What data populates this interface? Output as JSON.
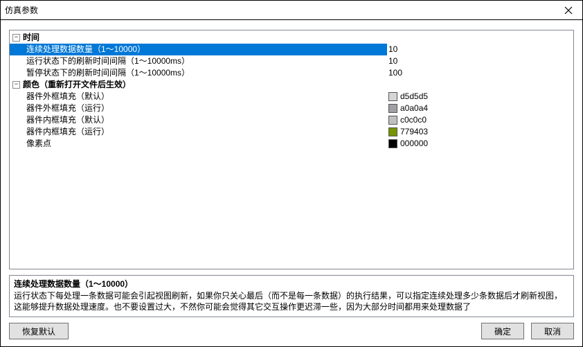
{
  "window": {
    "title": "仿真参数"
  },
  "groups": {
    "time": {
      "label": "时间",
      "items": {
        "cont_count": {
          "label": "连续处理数据数量（1～10000）",
          "value": "10"
        },
        "run_refresh": {
          "label": "运行状态下的刷新时间间隔（1～10000ms）",
          "value": "10"
        },
        "pause_refresh": {
          "label": "暂停状态下的刷新时间间隔（1～10000ms）",
          "value": "100"
        }
      }
    },
    "color": {
      "label": "颜色（重新打开文件后生效）",
      "items": {
        "outer_fill_default": {
          "label": "器件外框填充（默认）",
          "value": "d5d5d5",
          "hex": "#d5d5d5"
        },
        "outer_fill_run": {
          "label": "器件外框填充（运行）",
          "value": "a0a0a4",
          "hex": "#a0a0a4"
        },
        "inner_fill_default": {
          "label": "器件内框填充（默认）",
          "value": "c0c0c0",
          "hex": "#c0c0c0"
        },
        "inner_fill_run": {
          "label": "器件内框填充（运行）",
          "value": "779403",
          "hex": "#779403"
        },
        "pixel": {
          "label": "像素点",
          "value": "000000",
          "hex": "#000000"
        }
      }
    }
  },
  "help": {
    "title": "连续处理数据数量（1～10000）",
    "text": "运行状态下每处理一条数据可能会引起视图刷新，如果你只关心最后（而不是每一条数据）的执行结果，可以指定连续处理多少条数据后才刷新视图，这能够提升数据处理速度。也不要设置过大，不然你可能会觉得其它交互操作更迟滞一些，因为大部分时间都用来处理数据了"
  },
  "buttons": {
    "restore": "恢复默认",
    "ok": "确定",
    "cancel": "取消"
  }
}
